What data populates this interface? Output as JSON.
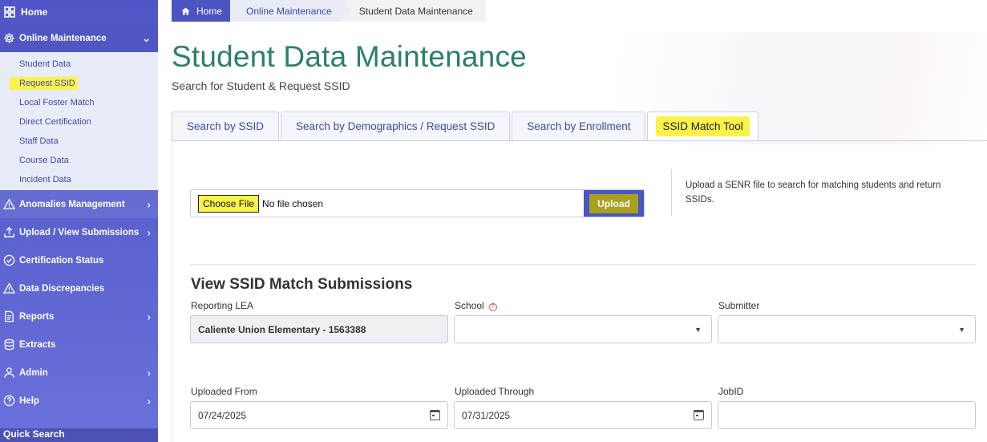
{
  "sidebar": {
    "home": "Home",
    "online_maintenance": "Online Maintenance",
    "sub_items": [
      {
        "label": "Student Data"
      },
      {
        "label": "Request SSID"
      },
      {
        "label": "Local Foster Match"
      },
      {
        "label": "Direct Certification"
      },
      {
        "label": "Staff Data"
      },
      {
        "label": "Course Data"
      },
      {
        "label": "Incident Data"
      }
    ],
    "anomalies": "Anomalies Management",
    "upload_view": "Upload / View Submissions",
    "certification": "Certification Status",
    "discrepancies": "Data Discrepancies",
    "reports": "Reports",
    "extracts": "Extracts",
    "admin": "Admin",
    "help": "Help",
    "quick_search": "Quick Search"
  },
  "breadcrumb": {
    "home": "Home",
    "middle": "Online Maintenance",
    "current": "Student Data Maintenance"
  },
  "page": {
    "title": "Student Data Maintenance",
    "subtitle": "Search for Student & Request SSID"
  },
  "tabs": [
    {
      "label": "Search by SSID"
    },
    {
      "label": "Search by Demographics / Request SSID"
    },
    {
      "label": "Search by Enrollment"
    },
    {
      "label": "SSID Match Tool"
    }
  ],
  "upload": {
    "choose_label": "Choose File",
    "file_status": "No file chosen",
    "upload_label": "Upload",
    "help": "Upload a SENR file to search for matching students and return SSIDs."
  },
  "submissions": {
    "title": "View SSID Match Submissions",
    "reporting_lea_label": "Reporting LEA",
    "reporting_lea_value": "Caliente Union Elementary - 1563388",
    "school_label": "School",
    "school_value": "",
    "submitter_label": "Submitter",
    "submitter_value": "",
    "uploaded_from_label": "Uploaded From",
    "uploaded_from_value": "07/24/2025",
    "uploaded_through_label": "Uploaded Through",
    "uploaded_through_value": "07/31/2025",
    "jobid_label": "JobID",
    "jobid_value": ""
  },
  "colors": {
    "sidebar": "#5a62d0",
    "title": "#2b7f6b",
    "highlight": "#fbf34a"
  }
}
